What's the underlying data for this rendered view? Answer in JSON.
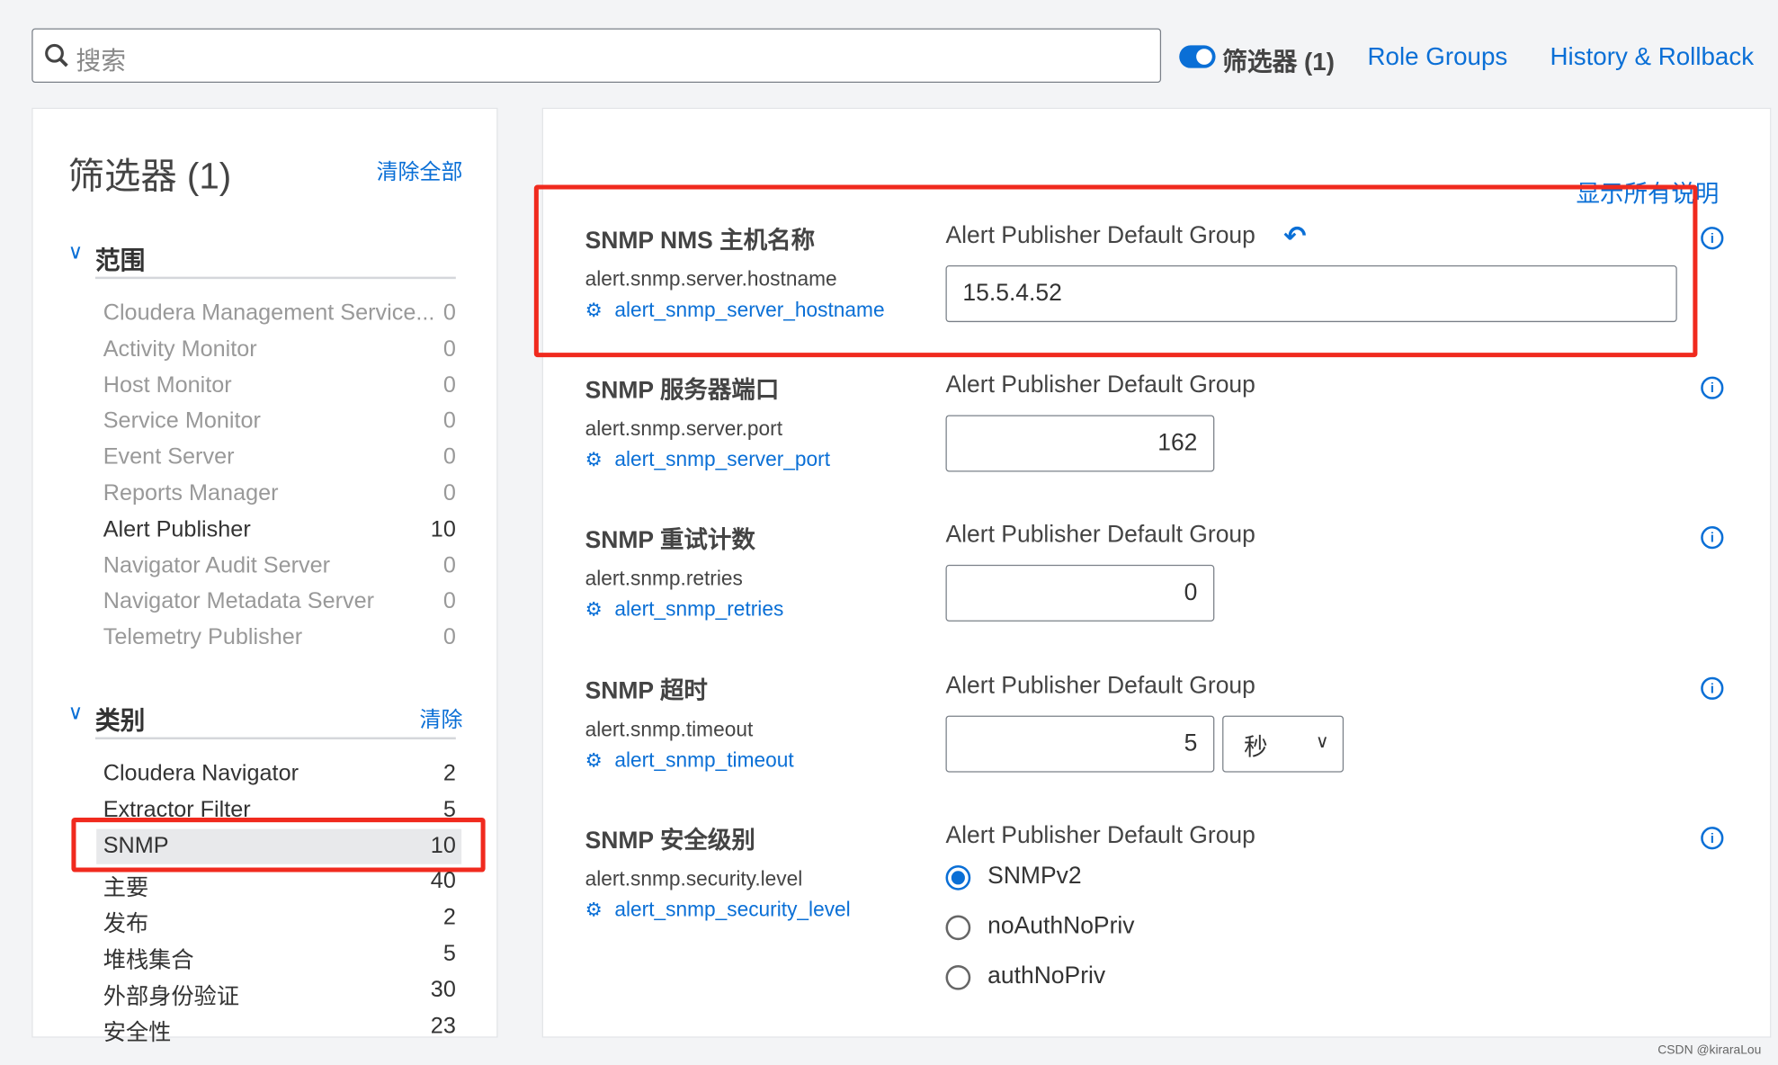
{
  "topbar": {
    "search_placeholder": "搜索",
    "filter_toggle_label": "筛选器 (1)",
    "role_groups": "Role Groups",
    "history": "History & Rollback"
  },
  "sidebar": {
    "title": "筛选器 (1)",
    "clear_all": "清除全部",
    "scope": {
      "label": "范围",
      "items": [
        {
          "label": "Cloudera Management Service...",
          "count": "0"
        },
        {
          "label": "Activity Monitor",
          "count": "0"
        },
        {
          "label": "Host Monitor",
          "count": "0"
        },
        {
          "label": "Service Monitor",
          "count": "0"
        },
        {
          "label": "Event Server",
          "count": "0"
        },
        {
          "label": "Reports Manager",
          "count": "0"
        },
        {
          "label": "Alert Publisher",
          "count": "10"
        },
        {
          "label": "Navigator Audit Server",
          "count": "0"
        },
        {
          "label": "Navigator Metadata Server",
          "count": "0"
        },
        {
          "label": "Telemetry Publisher",
          "count": "0"
        }
      ]
    },
    "category": {
      "label": "类别",
      "clear": "清除",
      "items": [
        {
          "label": "Cloudera Navigator",
          "count": "2"
        },
        {
          "label": "Extractor Filter",
          "count": "5"
        },
        {
          "label": "SNMP",
          "count": "10",
          "selected": true
        },
        {
          "label": "主要",
          "count": "40"
        },
        {
          "label": "发布",
          "count": "2"
        },
        {
          "label": "堆栈集合",
          "count": "5"
        },
        {
          "label": "外部身份验证",
          "count": "30"
        },
        {
          "label": "安全性",
          "count": "23"
        }
      ]
    }
  },
  "main": {
    "show_all_desc": "显示所有说明",
    "settings": [
      {
        "title": "SNMP NMS 主机名称",
        "key": "alert.snmp.server.hostname",
        "config": "alert_snmp_server_hostname",
        "group": "Alert Publisher Default Group",
        "value": "15.5.4.52"
      },
      {
        "title": "SNMP 服务器端口",
        "key": "alert.snmp.server.port",
        "config": "alert_snmp_server_port",
        "group": "Alert Publisher Default Group",
        "value": "162"
      },
      {
        "title": "SNMP 重试计数",
        "key": "alert.snmp.retries",
        "config": "alert_snmp_retries",
        "group": "Alert Publisher Default Group",
        "value": "0"
      },
      {
        "title": "SNMP 超时",
        "key": "alert.snmp.timeout",
        "config": "alert_snmp_timeout",
        "group": "Alert Publisher Default Group",
        "value": "5",
        "unit": "秒"
      },
      {
        "title": "SNMP 安全级别",
        "key": "alert.snmp.security.level",
        "config": "alert_snmp_security_level",
        "group": "Alert Publisher Default Group",
        "options": [
          "SNMPv2",
          "noAuthNoPriv",
          "authNoPriv"
        ],
        "selected": "SNMPv2"
      }
    ]
  },
  "footer": {
    "watermark": "CSDN @kiraraLou"
  },
  "colors": {
    "accent": "#0a6fd6",
    "highlight": "#f02a1e"
  }
}
